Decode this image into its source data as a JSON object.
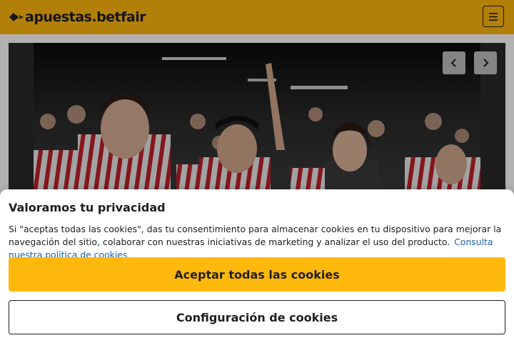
{
  "header": {
    "brand_name": "apuestas.betfair",
    "logo_icon": "betfair-arrows-logo",
    "menu_icon": "hamburger-menu-icon",
    "background_color": "#FFB80C"
  },
  "hero": {
    "image_subject": "football-supporters-crowd",
    "prev_icon": "chevron-left-icon",
    "next_icon": "chevron-right-icon"
  },
  "cookie_dialog": {
    "title": "Valoramos tu privacidad",
    "body": "Si \"aceptas todas las cookies\", das tu consentimiento para almacenar cookies en tu dispositivo para mejorar la navegación del sitio, colaborar con nuestras iniciativas de marketing y analizar el uso del producto.",
    "policy_link": "Consulta nuestra política de cookies",
    "accept_label": "Aceptar todas las cookies",
    "settings_label": "Configuración de cookies",
    "accent_color": "#FFB80C",
    "link_color": "#1b5fa8"
  }
}
